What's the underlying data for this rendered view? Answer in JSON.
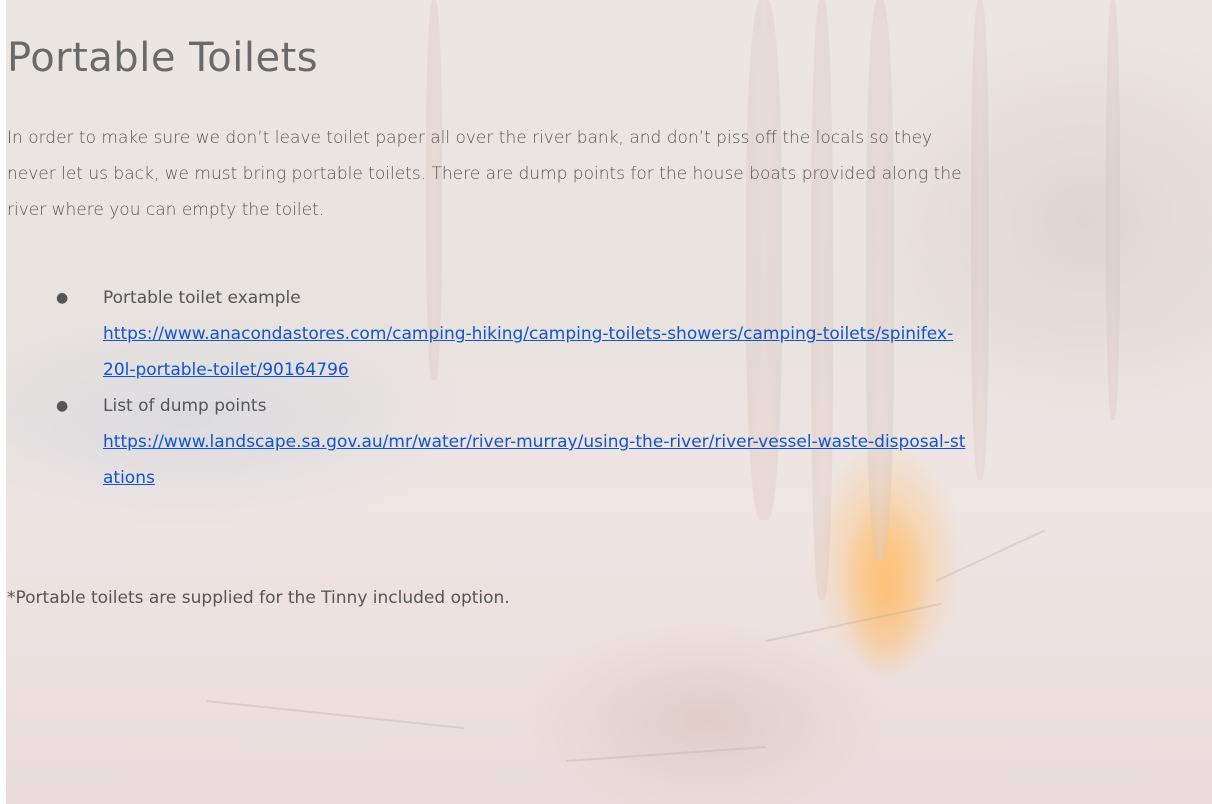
{
  "section": {
    "title": "Portable Toilets",
    "intro_lines": [
      "In order to make sure we don’t leave toilet paper all over the river bank, and don’t piss off the locals so they",
      "never let us back, we must bring portable toilets. There are dump points for the house boats provided along the",
      "river where you can empty the toilet."
    ]
  },
  "links": [
    {
      "bullet": "●",
      "label": "Portable toilet example",
      "url_line_1": "https://www.anacondastores.com/camping-hiking/camping-toilets-showers/camping-toilets/spinifex-",
      "url_line_2": "20l-portable-toilet/90164796"
    },
    {
      "bullet": "●",
      "label": "List of dump points",
      "url_line_1": "https://www.landscape.sa.gov.au/mr/water/river-murray/using-the-river/river-vessel-waste-disposal-st",
      "url_line_2": "ations"
    }
  ],
  "footnote": "*Portable toilets are supplied for the Tinny included option.",
  "colors": {
    "link": "#1155cc",
    "text": "#555555",
    "title": "#6a6a6a"
  }
}
